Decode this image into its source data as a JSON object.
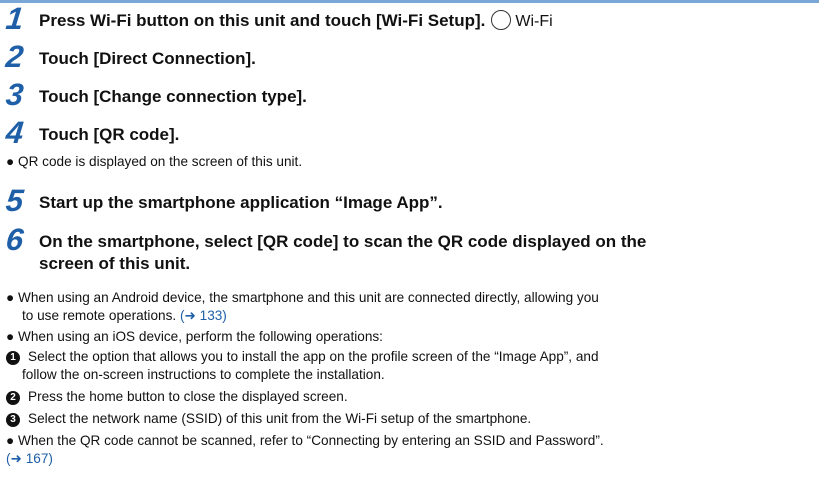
{
  "steps": [
    {
      "num": "1",
      "text": "Press Wi-Fi button on this unit and touch [Wi-Fi Setup].",
      "icon_label": "Wi-Fi"
    },
    {
      "num": "2",
      "text": "Touch [Direct Connection]."
    },
    {
      "num": "3",
      "text": "Touch [Change connection type]."
    },
    {
      "num": "4",
      "text": "Touch [QR code]."
    },
    {
      "num": "5",
      "text": "Start up the smartphone application “Image App”."
    },
    {
      "num": "6",
      "text_line1": "On the smartphone, select [QR code] to scan the QR code displayed on the",
      "text_line2": "screen of this unit."
    }
  ],
  "notes": {
    "n4": "QR code is displayed on the screen of this unit.",
    "android_l1": "When using an Android device, the smartphone and this unit are connected directly, allowing you",
    "android_l2": "to use remote operations.",
    "android_ref": "(➜ 133)",
    "ios": "When using an iOS device, perform the following operations:",
    "sub1_num": "1",
    "sub1_l1": "Select the option that allows you to install the app on the profile screen of the “Image App”, and",
    "sub1_l2": "follow the on-screen instructions to complete the installation.",
    "sub2_num": "2",
    "sub2": "Press the home button to close the displayed screen.",
    "sub3_num": "3",
    "sub3": "Select the network name (SSID) of this unit from the Wi-Fi setup of the smartphone.",
    "qr_fail": "When the QR code cannot be scanned, refer to “Connecting by entering an SSID and Password”.",
    "qr_fail_ref": "(➜ 167)"
  },
  "colors": {
    "step_number": "#1f5fa8",
    "link": "#1f5fa8",
    "rule": "#7ba7d6"
  }
}
